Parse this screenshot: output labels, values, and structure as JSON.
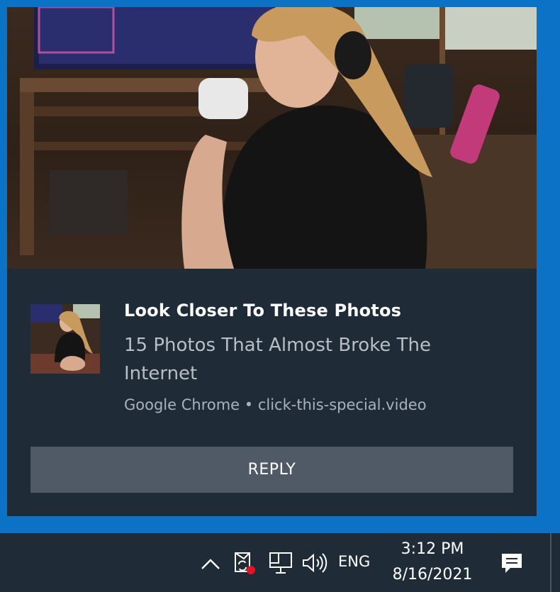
{
  "notification": {
    "title": "Look Closer To These Photos",
    "body": "15 Photos That Almost Broke The Internet",
    "source": "Google Chrome • click-this-special.video",
    "reply_label": "REPLY",
    "hero_image": "promotional-photo",
    "thumbnail_image": "promotional-thumbnail"
  },
  "taskbar": {
    "language": "ENG",
    "time": "3:12 PM",
    "date": "8/16/2021",
    "icons": [
      "chevron-up-icon",
      "security-alert-icon",
      "network-icon",
      "volume-icon",
      "action-center-icon"
    ]
  },
  "colors": {
    "desktop_accent": "#0b72c6",
    "toast_background": "#1f2b37",
    "reply_button": "#4f5a66",
    "alert_badge": "#e81123"
  }
}
